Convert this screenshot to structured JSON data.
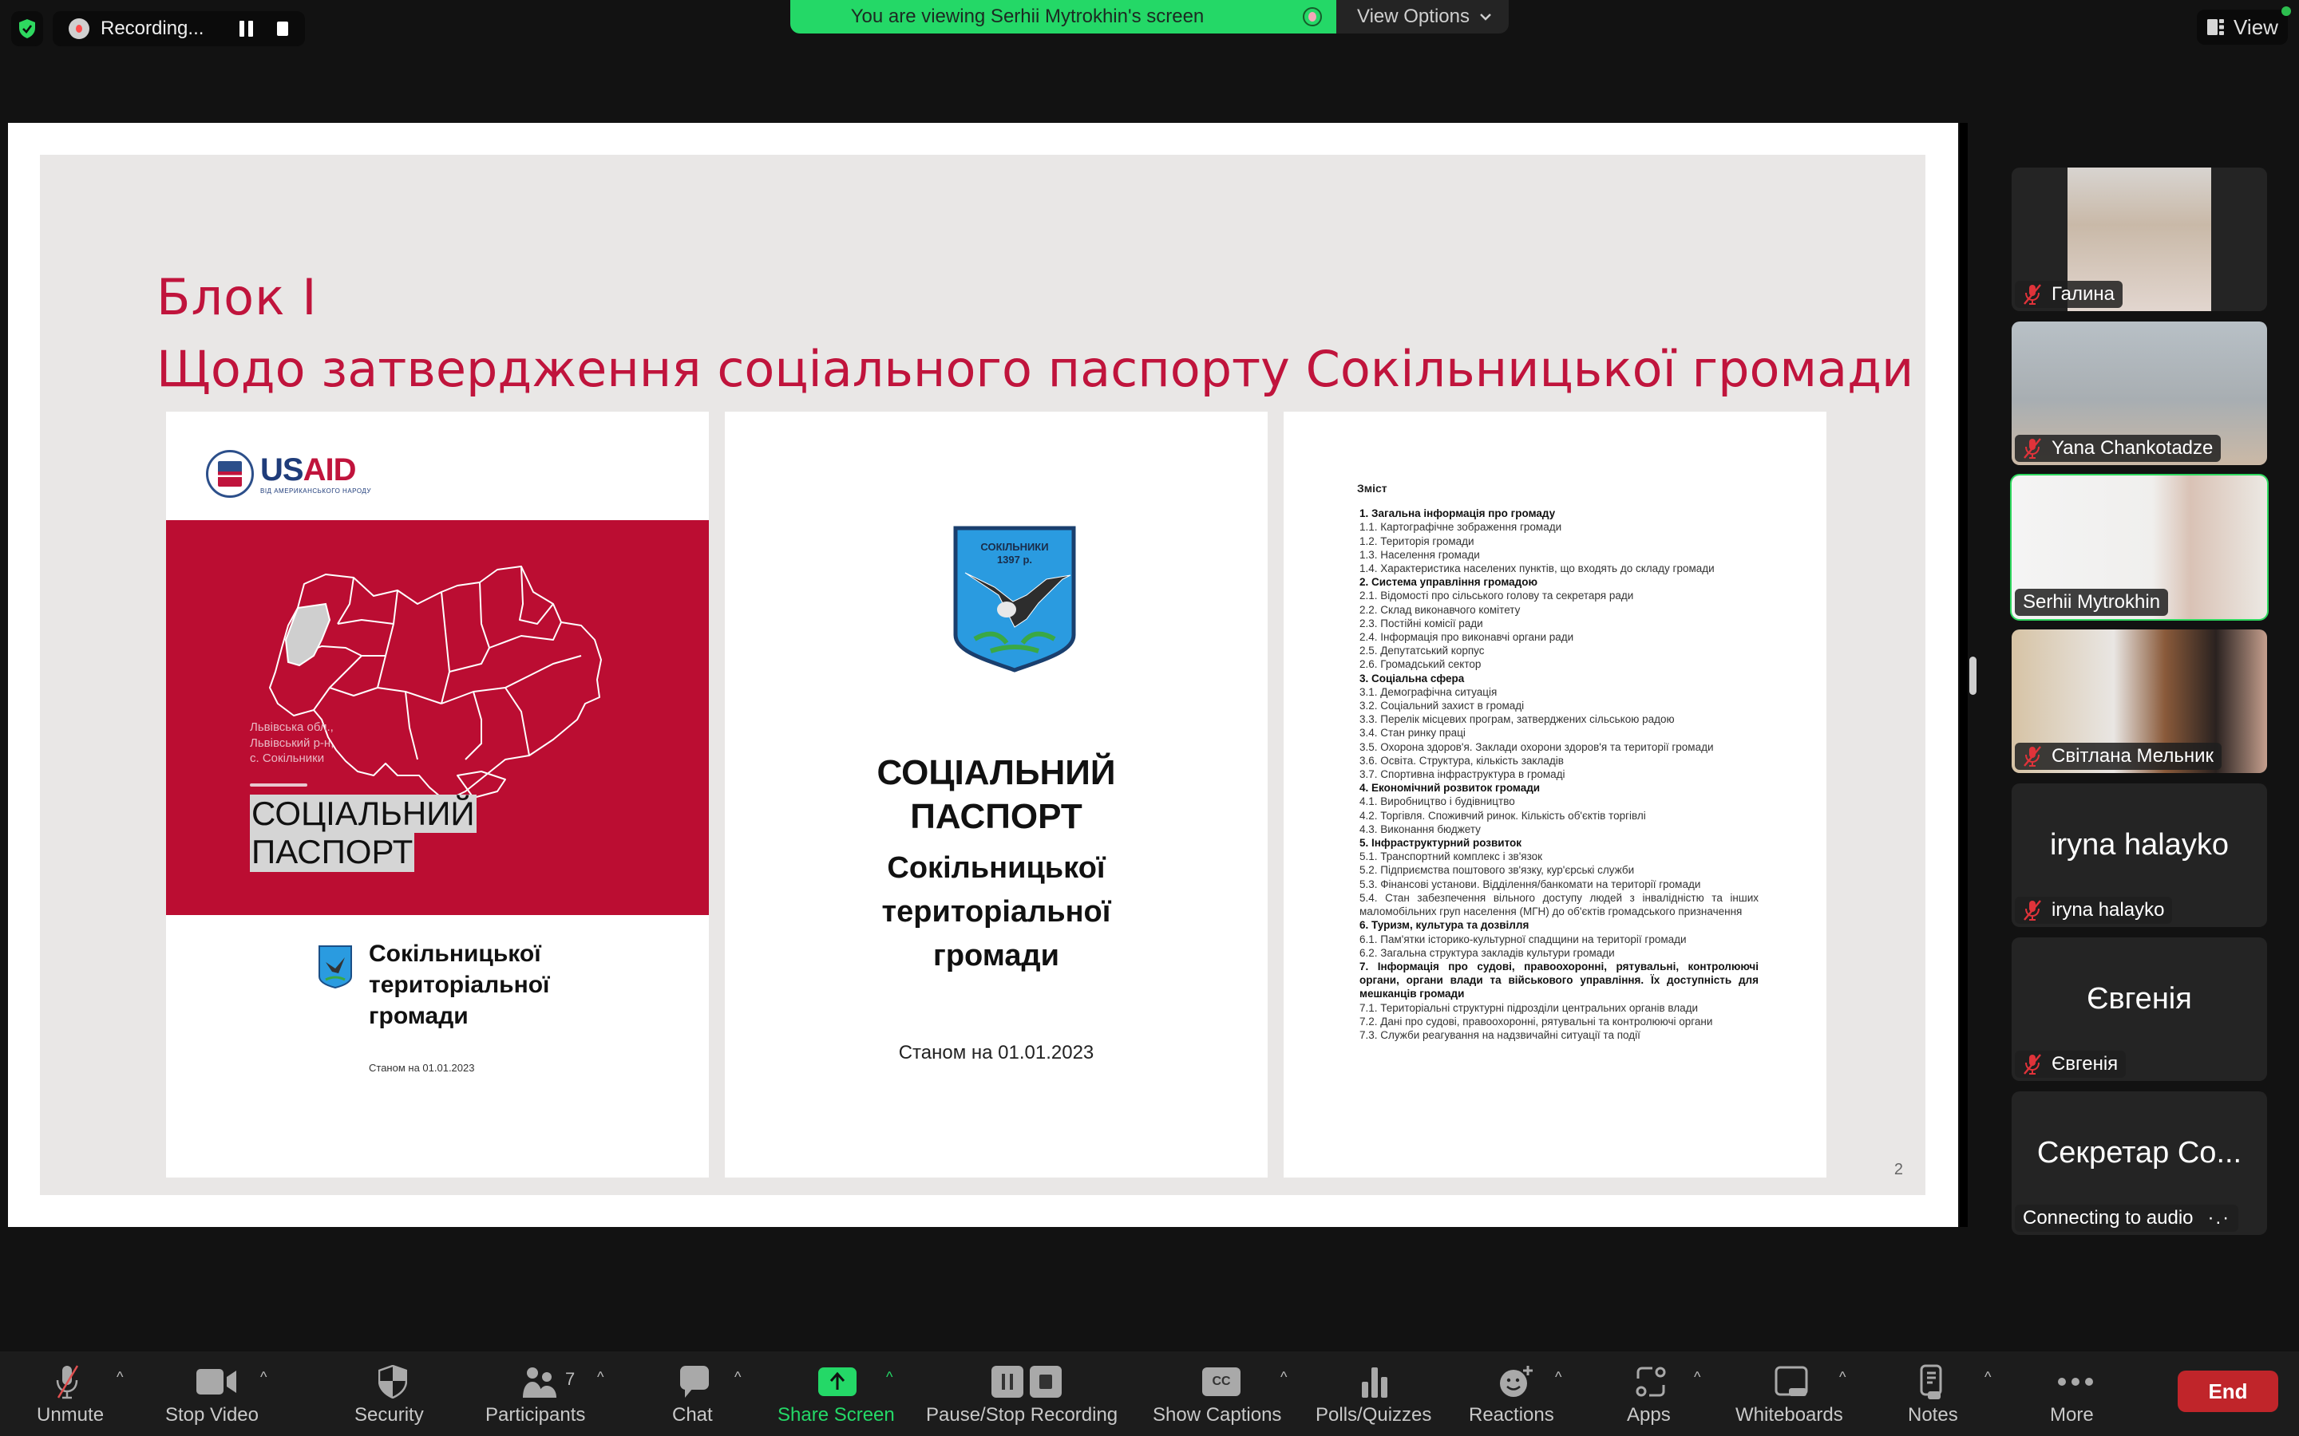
{
  "top_bar": {
    "security_status_icon": "shield-check-icon",
    "recording_label": "Recording...",
    "viewing_banner": "You are viewing Serhii Mytrokhin's screen",
    "view_options_label": "View Options",
    "view_label": "View"
  },
  "slide": {
    "title_line1": "Блок І",
    "title_line2": "Щодо затвердження соціального паспорту Сокільницької громади",
    "page_number": "2",
    "accent_color": "#c0143c",
    "doc1": {
      "logo_text_us": "US",
      "logo_text_aid": "AID",
      "logo_subtitle": "ВІД АМЕРИКАНСЬКОГО НАРОДУ",
      "region_caption": [
        "Львівська обл.,",
        "Львівський р-н,",
        "с. Сокільники"
      ],
      "passport_title": [
        "СОЦІАЛЬНИЙ",
        "ПАСПОРТ"
      ],
      "community_title": [
        "Сокільницької",
        "територіальної",
        "громади"
      ],
      "date": "Станом на 01.01.2023"
    },
    "doc2": {
      "crest_text": [
        "СОКІЛЬНИКИ",
        "1397 р."
      ],
      "title": [
        "СОЦІАЛЬНИЙ",
        "ПАСПОРТ"
      ],
      "subtitle": [
        "Сокільницької",
        "територіальної",
        "громади"
      ],
      "date": "Станом на 01.01.2023"
    },
    "doc3": {
      "heading": "Зміст",
      "items": [
        {
          "text": "1. Загальна інформація про громаду",
          "bold": true
        },
        {
          "text": "1.1. Картографічне зображення громади",
          "bold": false
        },
        {
          "text": "1.2. Територія громади",
          "bold": false
        },
        {
          "text": "1.3. Населення громади",
          "bold": false
        },
        {
          "text": "1.4. Характеристика населених пунктів, що входять до складу громади",
          "bold": false
        },
        {
          "text": "2. Система управління громадою",
          "bold": true
        },
        {
          "text": "2.1. Відомості про сільського голову та секретаря ради",
          "bold": false
        },
        {
          "text": "2.2. Склад виконавчого комітету",
          "bold": false
        },
        {
          "text": "2.3. Постійні комісії ради",
          "bold": false
        },
        {
          "text": "2.4. Інформація про виконавчі органи ради",
          "bold": false
        },
        {
          "text": "2.5. Депутатський корпус",
          "bold": false
        },
        {
          "text": "2.6. Громадський сектор",
          "bold": false
        },
        {
          "text": "3. Соціальна сфера",
          "bold": true
        },
        {
          "text": "3.1. Демографічна ситуація",
          "bold": false
        },
        {
          "text": "3.2. Соціальний захист в громаді",
          "bold": false
        },
        {
          "text": "3.3. Перелік місцевих програм, затверджених сільською радою",
          "bold": false
        },
        {
          "text": "3.4. Стан ринку праці",
          "bold": false
        },
        {
          "text": "3.5. Охорона здоров'я. Заклади охорони здоров'я та території громади",
          "bold": false
        },
        {
          "text": "3.6. Освіта. Структура, кількість закладів",
          "bold": false
        },
        {
          "text": "3.7. Спортивна інфраструктура в громаді",
          "bold": false
        },
        {
          "text": "4. Економічний розвиток громади",
          "bold": true
        },
        {
          "text": "4.1. Виробництво і будівництво",
          "bold": false
        },
        {
          "text": "4.2. Торгівля. Споживчий ринок. Кількість об'єктів торгівлі",
          "bold": false
        },
        {
          "text": "4.3. Виконання бюджету",
          "bold": false
        },
        {
          "text": "5. Інфраструктурний розвиток",
          "bold": true
        },
        {
          "text": "5.1. Транспортний комплекс і зв'язок",
          "bold": false
        },
        {
          "text": "5.2. Підприємства поштового зв'язку, кур'єрські служби",
          "bold": false
        },
        {
          "text": "5.3. Фінансові установи. Відділення/банкомати на території громади",
          "bold": false
        },
        {
          "text": "5.4. Стан забезпечення вільного доступу людей з інвалідністю та інших маломобільних груп населення (МГН) до об'єктів громадського призначення",
          "bold": false
        },
        {
          "text": "6. Туризм, культура та дозвілля",
          "bold": true
        },
        {
          "text": "6.1. Пам'ятки історико-культурної спадщини на території громади",
          "bold": false
        },
        {
          "text": "6.2. Загальна структура закладів культури громади",
          "bold": false
        },
        {
          "text": "7. Інформація про судові, правоохоронні, рятувальні, контролюючі органи, органи влади та військового управління. Їх доступність для мешканців громади",
          "bold": true
        },
        {
          "text": "7.1. Територіальні структурні підрозділи центральних органів влади",
          "bold": false
        },
        {
          "text": "7.2. Дані про судові, правоохоронні, рятувальні та контролюючі органи",
          "bold": false
        },
        {
          "text": "7.3. Служби реагування на надзвичайні ситуації та події",
          "bold": false
        }
      ]
    }
  },
  "participants": [
    {
      "name": "Галина",
      "muted": true,
      "video": true
    },
    {
      "name": "Yana Chankotadze",
      "muted": true,
      "video": true
    },
    {
      "name": "Serhii Mytrokhin",
      "muted": false,
      "video": true,
      "active_speaker": true
    },
    {
      "name": "Світлана Мельник",
      "muted": true,
      "video": true
    },
    {
      "name": "iryna halayko",
      "muted": true,
      "video": false,
      "display_name": "iryna halayko"
    },
    {
      "name": "Євгенія",
      "muted": true,
      "video": false,
      "display_name": "Євгенія"
    },
    {
      "name": "Connecting to audio",
      "muted": false,
      "video": false,
      "display_name": "Секретар Со...",
      "status": "Connecting to audio"
    }
  ],
  "toolbar": {
    "unmute": "Unmute",
    "stop_video": "Stop Video",
    "security": "Security",
    "participants": "Participants",
    "participants_count": "7",
    "chat": "Chat",
    "share_screen": "Share Screen",
    "pause_stop_recording": "Pause/Stop Recording",
    "show_captions": "Show Captions",
    "captions_glyph": "CC",
    "polls": "Polls/Quizzes",
    "reactions": "Reactions",
    "apps": "Apps",
    "whiteboards": "Whiteboards",
    "notes": "Notes",
    "more": "More",
    "end": "End",
    "share_color": "#24d867",
    "end_color": "#c0252a"
  }
}
